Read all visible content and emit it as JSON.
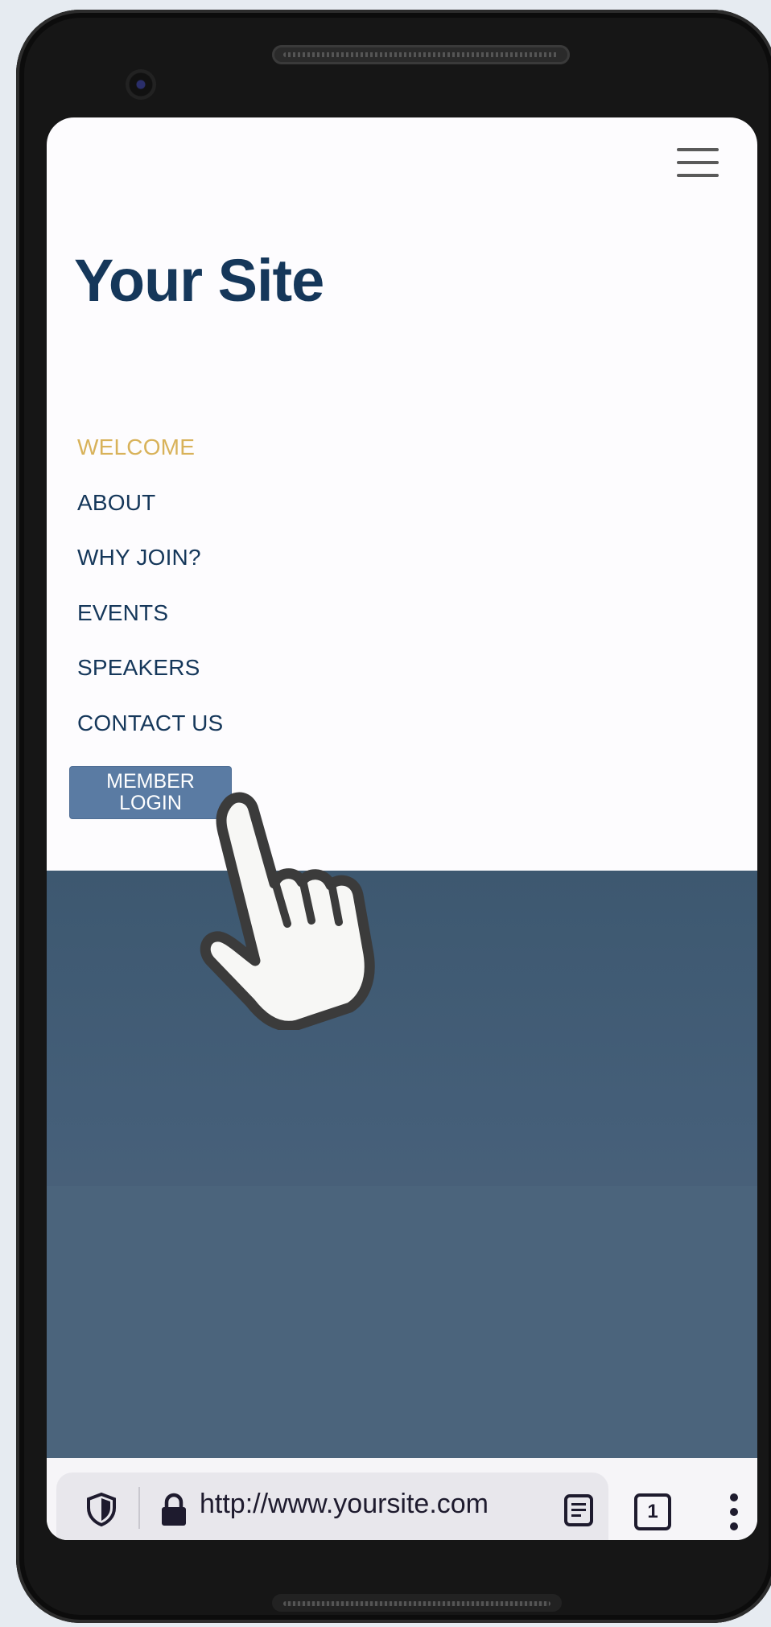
{
  "site": {
    "title": "Your Site"
  },
  "nav": {
    "items": [
      {
        "label": "WELCOME",
        "active": true
      },
      {
        "label": "ABOUT",
        "active": false
      },
      {
        "label": "WHY JOIN?",
        "active": false
      },
      {
        "label": "EVENTS",
        "active": false
      },
      {
        "label": "SPEAKERS",
        "active": false
      },
      {
        "label": "CONTACT US",
        "active": false
      }
    ],
    "login_button": "MEMBER\nLOGIN"
  },
  "browser": {
    "url": "http://www.yoursite.com",
    "tab_count": "1"
  },
  "icons": {
    "menu": "hamburger-menu-icon",
    "tracking": "shield-icon",
    "lock": "lock-icon",
    "reader": "reader-mode-icon",
    "tabs": "tab-counter-icon",
    "more": "more-vertical-icon",
    "cursor": "hand-pointer-icon"
  },
  "colors": {
    "title": "#15375a",
    "nav_active": "#d8b25a",
    "nav": "#15375a",
    "button": "#5a7ba3",
    "hero": "#455f79"
  }
}
